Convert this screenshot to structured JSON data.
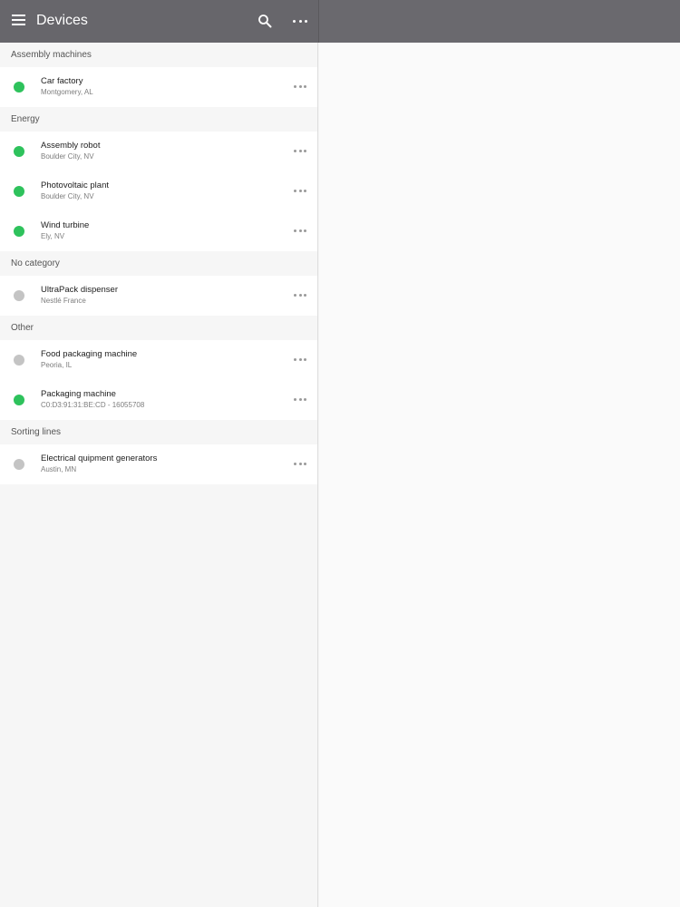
{
  "appbar": {
    "title": "Devices",
    "menu_icon": "menu-icon",
    "search_icon": "search-icon",
    "more_icon": "more-vert-icon",
    "background": "#67666b"
  },
  "status_colors": {
    "online": "#2ec25c",
    "offline": "#c4c4c4"
  },
  "sections": [
    {
      "title": "Assembly machines",
      "devices": [
        {
          "name": "Car factory",
          "location": "Montgomery, AL",
          "status": "online"
        }
      ]
    },
    {
      "title": "Energy",
      "devices": [
        {
          "name": "Assembly robot",
          "location": "Boulder City, NV",
          "status": "online"
        },
        {
          "name": "Photovoltaic plant",
          "location": "Boulder City, NV",
          "status": "online"
        },
        {
          "name": "Wind turbine",
          "location": "Ely, NV",
          "status": "online"
        }
      ]
    },
    {
      "title": "No category",
      "devices": [
        {
          "name": "UltraPack dispenser",
          "location": "Nestlé France",
          "status": "offline"
        }
      ]
    },
    {
      "title": "Other",
      "devices": [
        {
          "name": "Food packaging machine",
          "location": "Peoria, IL",
          "status": "offline"
        },
        {
          "name": "Packaging machine",
          "location": "C0:D3:91:31:BE:CD - 16055708",
          "status": "online"
        }
      ]
    },
    {
      "title": "Sorting lines",
      "devices": [
        {
          "name": "Electrical quipment generators",
          "location": "Austin, MN",
          "status": "offline"
        }
      ]
    }
  ]
}
